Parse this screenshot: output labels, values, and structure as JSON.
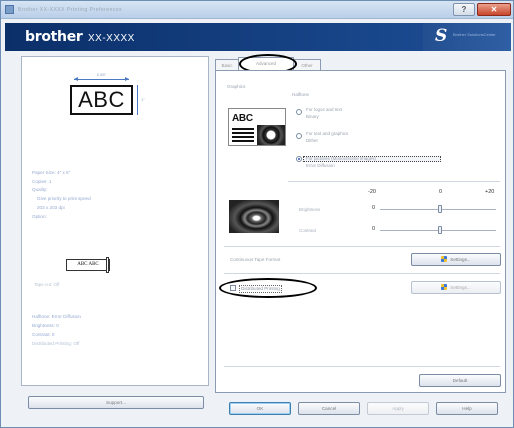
{
  "window": {
    "title": "Brother XX-XXXX Printing Preferences",
    "help_glyph": "?",
    "close_glyph": "✕"
  },
  "banner": {
    "brand": "brother",
    "model": "XX-XXXX",
    "logo_glyph": "S",
    "logo_text": "Brother SolutionsCenter"
  },
  "preview": {
    "width_label": "0.85\"",
    "height_label": "1\"",
    "sample_text": "ABC"
  },
  "summary": {
    "lines": [
      {
        "text": "Paper Size: 4\" x 6\"",
        "indent": false
      },
      {
        "text": "Copies: 1",
        "indent": false
      },
      {
        "text": "Quality:",
        "indent": false
      },
      {
        "text": "Give priority to print speed",
        "indent": true
      },
      {
        "text": "203 x 203 dpi",
        "indent": true
      },
      {
        "text": "Option:",
        "indent": false
      }
    ],
    "cut_sample": "ABC ABC",
    "cut_note": "Tape cut: Off",
    "lines2": [
      {
        "text": "Halftone: Error Diffusion",
        "faint": false
      },
      {
        "text": "Brightness: 0",
        "faint": false
      },
      {
        "text": "Contrast: 0",
        "faint": false
      },
      {
        "text": "Distributed Printing: Off",
        "faint": true
      }
    ],
    "support_button": "Support..."
  },
  "tabs": [
    {
      "label": "Basic",
      "active": false
    },
    {
      "label": "Advanced",
      "active": true
    },
    {
      "label": "Other",
      "active": false
    }
  ],
  "advanced": {
    "graphics_label": "Graphics",
    "halftone_label": "Halftone",
    "halftone_options": [
      {
        "label": "For logos and text",
        "sub": "Binary",
        "selected": false
      },
      {
        "label": "For text and graphics",
        "sub": "Dither",
        "selected": false
      },
      {
        "label": "For pictures (Monochrome images)",
        "sub": "Error Diffusion",
        "selected": true
      }
    ],
    "icon_text": "ABC",
    "scale_min": "-20",
    "scale_mid": "0",
    "scale_max": "+20",
    "brightness_label": "Brightness",
    "brightness_value": "0",
    "contrast_label": "Contrast",
    "contrast_value": "0",
    "continuous_tape_label": "Continuous Tape Format",
    "settings_button": "Settings...",
    "distributed_label": "Distributed Printing",
    "distributed_checked": false,
    "settings_button_disabled": "Settings...",
    "default_button": "Default"
  },
  "footer": {
    "ok": "OK",
    "cancel": "Cancel",
    "apply": "Apply",
    "help": "Help"
  },
  "colors": {
    "banner": "#0b2f69",
    "accent": "#2b5ab3"
  }
}
